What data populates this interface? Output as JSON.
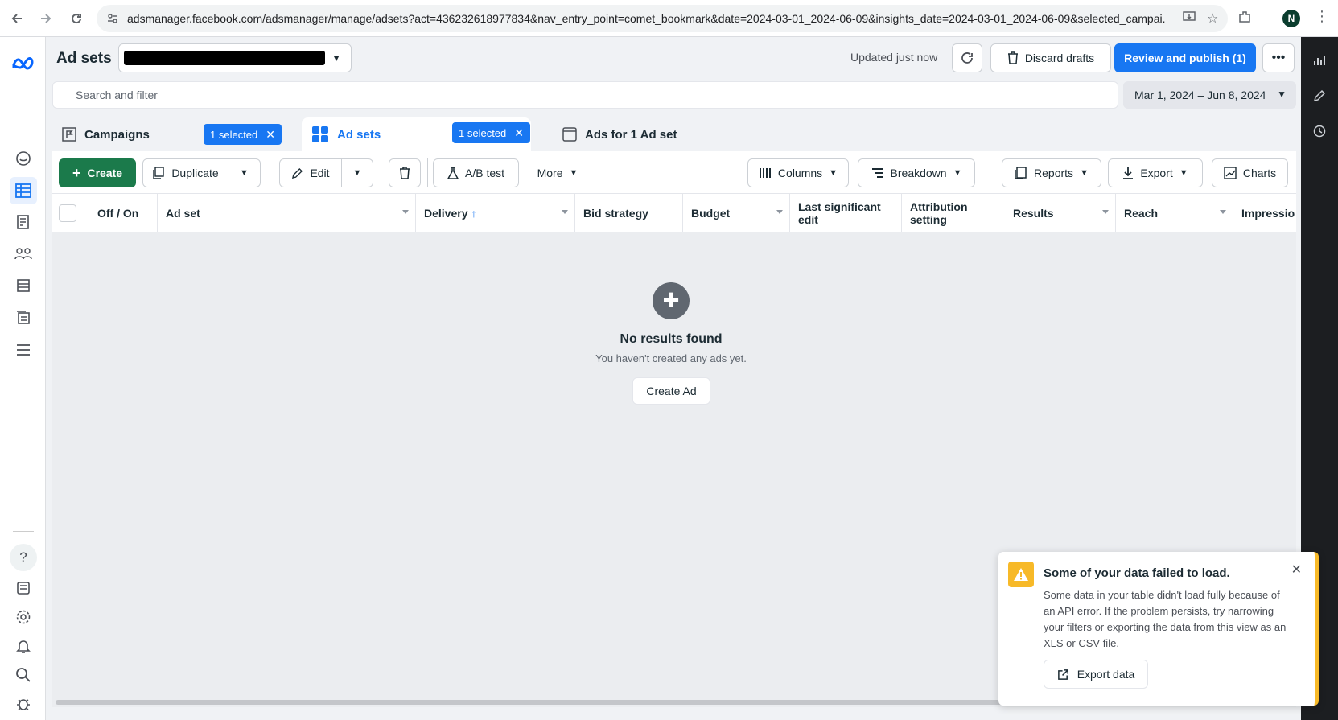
{
  "browser": {
    "url": "adsmanager.facebook.com/adsmanager/manage/adsets?act=436232618977834&nav_entry_point=comet_bookmark&date=2024-03-01_2024-06-09&insights_date=2024-03-01_2024-06-09&selected_campai...",
    "profile_initial": "N"
  },
  "header": {
    "title": "Ad sets",
    "updated": "Updated just now",
    "discard": "Discard drafts",
    "publish": "Review and publish (1)"
  },
  "search": {
    "placeholder": "Search and filter"
  },
  "date_range": "Mar 1, 2024 – Jun 8, 2024",
  "tabs": [
    {
      "label": "Campaigns",
      "chip": "1 selected"
    },
    {
      "label": "Ad sets",
      "chip": "1 selected"
    },
    {
      "label": "Ads for 1 Ad set"
    }
  ],
  "toolbar": {
    "create": "Create",
    "duplicate": "Duplicate",
    "edit": "Edit",
    "ab_test": "A/B test",
    "more": "More",
    "columns": "Columns",
    "breakdown": "Breakdown",
    "reports": "Reports",
    "export": "Export",
    "charts": "Charts"
  },
  "columns": [
    "Off / On",
    "Ad set",
    "Delivery",
    "Bid strategy",
    "Budget",
    "Last significant edit",
    "Attribution setting",
    "Results",
    "Reach",
    "Impressio"
  ],
  "empty_state": {
    "title": "No results found",
    "subtitle": "You haven't created any ads yet.",
    "button": "Create Ad"
  },
  "toast": {
    "title": "Some of your data failed to load.",
    "body": "Some data in your table didn't load fully because of an API error. If the problem persists, try narrowing your filters or exporting the data from this view as an XLS or CSV file.",
    "button": "Export data"
  },
  "colors": {
    "accent": "#1877f2",
    "create_green": "#1b7a4b",
    "warning": "#f7b928"
  }
}
